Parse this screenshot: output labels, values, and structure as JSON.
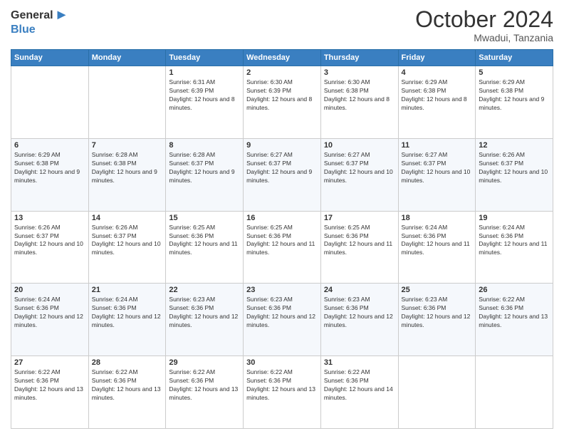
{
  "logo": {
    "general": "General",
    "blue": "Blue"
  },
  "header": {
    "month": "October 2024",
    "location": "Mwadui, Tanzania"
  },
  "weekdays": [
    "Sunday",
    "Monday",
    "Tuesday",
    "Wednesday",
    "Thursday",
    "Friday",
    "Saturday"
  ],
  "weeks": [
    [
      {
        "day": "",
        "sunrise": "",
        "sunset": "",
        "daylight": ""
      },
      {
        "day": "",
        "sunrise": "",
        "sunset": "",
        "daylight": ""
      },
      {
        "day": "1",
        "sunrise": "Sunrise: 6:31 AM",
        "sunset": "Sunset: 6:39 PM",
        "daylight": "Daylight: 12 hours and 8 minutes."
      },
      {
        "day": "2",
        "sunrise": "Sunrise: 6:30 AM",
        "sunset": "Sunset: 6:39 PM",
        "daylight": "Daylight: 12 hours and 8 minutes."
      },
      {
        "day": "3",
        "sunrise": "Sunrise: 6:30 AM",
        "sunset": "Sunset: 6:38 PM",
        "daylight": "Daylight: 12 hours and 8 minutes."
      },
      {
        "day": "4",
        "sunrise": "Sunrise: 6:29 AM",
        "sunset": "Sunset: 6:38 PM",
        "daylight": "Daylight: 12 hours and 8 minutes."
      },
      {
        "day": "5",
        "sunrise": "Sunrise: 6:29 AM",
        "sunset": "Sunset: 6:38 PM",
        "daylight": "Daylight: 12 hours and 9 minutes."
      }
    ],
    [
      {
        "day": "6",
        "sunrise": "Sunrise: 6:29 AM",
        "sunset": "Sunset: 6:38 PM",
        "daylight": "Daylight: 12 hours and 9 minutes."
      },
      {
        "day": "7",
        "sunrise": "Sunrise: 6:28 AM",
        "sunset": "Sunset: 6:38 PM",
        "daylight": "Daylight: 12 hours and 9 minutes."
      },
      {
        "day": "8",
        "sunrise": "Sunrise: 6:28 AM",
        "sunset": "Sunset: 6:37 PM",
        "daylight": "Daylight: 12 hours and 9 minutes."
      },
      {
        "day": "9",
        "sunrise": "Sunrise: 6:27 AM",
        "sunset": "Sunset: 6:37 PM",
        "daylight": "Daylight: 12 hours and 9 minutes."
      },
      {
        "day": "10",
        "sunrise": "Sunrise: 6:27 AM",
        "sunset": "Sunset: 6:37 PM",
        "daylight": "Daylight: 12 hours and 10 minutes."
      },
      {
        "day": "11",
        "sunrise": "Sunrise: 6:27 AM",
        "sunset": "Sunset: 6:37 PM",
        "daylight": "Daylight: 12 hours and 10 minutes."
      },
      {
        "day": "12",
        "sunrise": "Sunrise: 6:26 AM",
        "sunset": "Sunset: 6:37 PM",
        "daylight": "Daylight: 12 hours and 10 minutes."
      }
    ],
    [
      {
        "day": "13",
        "sunrise": "Sunrise: 6:26 AM",
        "sunset": "Sunset: 6:37 PM",
        "daylight": "Daylight: 12 hours and 10 minutes."
      },
      {
        "day": "14",
        "sunrise": "Sunrise: 6:26 AM",
        "sunset": "Sunset: 6:37 PM",
        "daylight": "Daylight: 12 hours and 10 minutes."
      },
      {
        "day": "15",
        "sunrise": "Sunrise: 6:25 AM",
        "sunset": "Sunset: 6:36 PM",
        "daylight": "Daylight: 12 hours and 11 minutes."
      },
      {
        "day": "16",
        "sunrise": "Sunrise: 6:25 AM",
        "sunset": "Sunset: 6:36 PM",
        "daylight": "Daylight: 12 hours and 11 minutes."
      },
      {
        "day": "17",
        "sunrise": "Sunrise: 6:25 AM",
        "sunset": "Sunset: 6:36 PM",
        "daylight": "Daylight: 12 hours and 11 minutes."
      },
      {
        "day": "18",
        "sunrise": "Sunrise: 6:24 AM",
        "sunset": "Sunset: 6:36 PM",
        "daylight": "Daylight: 12 hours and 11 minutes."
      },
      {
        "day": "19",
        "sunrise": "Sunrise: 6:24 AM",
        "sunset": "Sunset: 6:36 PM",
        "daylight": "Daylight: 12 hours and 11 minutes."
      }
    ],
    [
      {
        "day": "20",
        "sunrise": "Sunrise: 6:24 AM",
        "sunset": "Sunset: 6:36 PM",
        "daylight": "Daylight: 12 hours and 12 minutes."
      },
      {
        "day": "21",
        "sunrise": "Sunrise: 6:24 AM",
        "sunset": "Sunset: 6:36 PM",
        "daylight": "Daylight: 12 hours and 12 minutes."
      },
      {
        "day": "22",
        "sunrise": "Sunrise: 6:23 AM",
        "sunset": "Sunset: 6:36 PM",
        "daylight": "Daylight: 12 hours and 12 minutes."
      },
      {
        "day": "23",
        "sunrise": "Sunrise: 6:23 AM",
        "sunset": "Sunset: 6:36 PM",
        "daylight": "Daylight: 12 hours and 12 minutes."
      },
      {
        "day": "24",
        "sunrise": "Sunrise: 6:23 AM",
        "sunset": "Sunset: 6:36 PM",
        "daylight": "Daylight: 12 hours and 12 minutes."
      },
      {
        "day": "25",
        "sunrise": "Sunrise: 6:23 AM",
        "sunset": "Sunset: 6:36 PM",
        "daylight": "Daylight: 12 hours and 12 minutes."
      },
      {
        "day": "26",
        "sunrise": "Sunrise: 6:22 AM",
        "sunset": "Sunset: 6:36 PM",
        "daylight": "Daylight: 12 hours and 13 minutes."
      }
    ],
    [
      {
        "day": "27",
        "sunrise": "Sunrise: 6:22 AM",
        "sunset": "Sunset: 6:36 PM",
        "daylight": "Daylight: 12 hours and 13 minutes."
      },
      {
        "day": "28",
        "sunrise": "Sunrise: 6:22 AM",
        "sunset": "Sunset: 6:36 PM",
        "daylight": "Daylight: 12 hours and 13 minutes."
      },
      {
        "day": "29",
        "sunrise": "Sunrise: 6:22 AM",
        "sunset": "Sunset: 6:36 PM",
        "daylight": "Daylight: 12 hours and 13 minutes."
      },
      {
        "day": "30",
        "sunrise": "Sunrise: 6:22 AM",
        "sunset": "Sunset: 6:36 PM",
        "daylight": "Daylight: 12 hours and 13 minutes."
      },
      {
        "day": "31",
        "sunrise": "Sunrise: 6:22 AM",
        "sunset": "Sunset: 6:36 PM",
        "daylight": "Daylight: 12 hours and 14 minutes."
      },
      {
        "day": "",
        "sunrise": "",
        "sunset": "",
        "daylight": ""
      },
      {
        "day": "",
        "sunrise": "",
        "sunset": "",
        "daylight": ""
      }
    ]
  ]
}
